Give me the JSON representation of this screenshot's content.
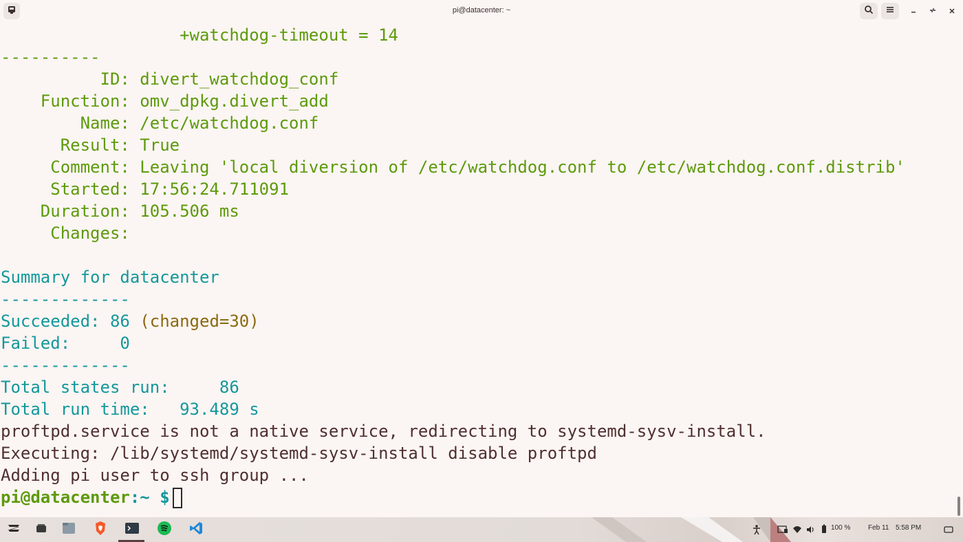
{
  "window": {
    "title": "pi@datacenter: ~"
  },
  "terminal": {
    "lines": [
      {
        "text": "                  +watchdog-timeout = 14",
        "cls": "green"
      },
      {
        "text": "----------",
        "cls": "green"
      },
      {
        "text": "          ID: divert_watchdog_conf",
        "cls": "green"
      },
      {
        "text": "    Function: omv_dpkg.divert_add",
        "cls": "green"
      },
      {
        "text": "        Name: /etc/watchdog.conf",
        "cls": "green"
      },
      {
        "text": "      Result: True",
        "cls": "green"
      },
      {
        "text": "     Comment: Leaving 'local diversion of /etc/watchdog.conf to /etc/watchdog.conf.distrib'",
        "cls": "green"
      },
      {
        "text": "     Started: 17:56:24.711091",
        "cls": "green"
      },
      {
        "text": "    Duration: 105.506 ms",
        "cls": "green"
      },
      {
        "text": "     Changes:",
        "cls": "green"
      },
      {
        "text": "",
        "cls": "green"
      },
      {
        "text": "Summary for datacenter",
        "cls": "teal"
      },
      {
        "text": "-------------",
        "cls": "teal"
      },
      {
        "text": "Succeeded: 86 (changed=30)",
        "cls": "mixed-succeeded"
      },
      {
        "text": "Failed:     0",
        "cls": "teal"
      },
      {
        "text": "-------------",
        "cls": "teal"
      },
      {
        "text": "Total states run:     86",
        "cls": "teal"
      },
      {
        "text": "Total run time:   93.489 s",
        "cls": "teal"
      },
      {
        "text": "proftpd.service is not a native service, redirecting to systemd-sysv-install.",
        "cls": "brown"
      },
      {
        "text": "Executing: /lib/systemd/systemd-sysv-install disable proftpd",
        "cls": "brown"
      },
      {
        "text": "Adding pi user to ssh group ...",
        "cls": "brown"
      }
    ],
    "succeeded_label": "Succeeded: 86 ",
    "succeeded_changed": "(changed=30)",
    "prompt_user": "pi@datacenter",
    "prompt_path": ":~",
    "prompt_symbol": " $"
  },
  "taskbar": {
    "battery": "100 %",
    "date": "Feb 11",
    "time": "5:58 PM"
  },
  "icons": {
    "app_menu": "app-menu-icon",
    "search": "search-icon",
    "hamburger": "hamburger-menu-icon",
    "minimize": "minimize-icon",
    "restore": "restore-icon",
    "close": "close-icon"
  }
}
